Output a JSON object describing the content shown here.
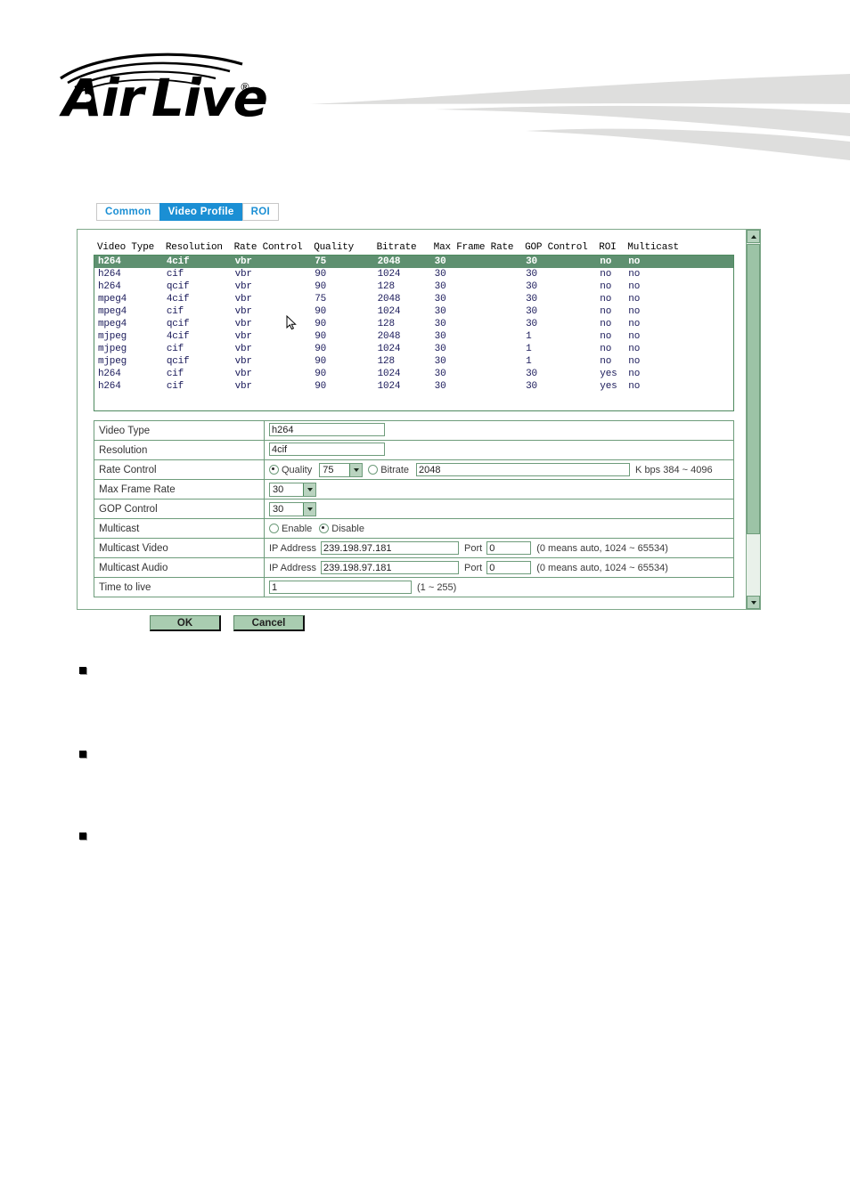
{
  "brand": {
    "name": "AirLive",
    "trademark": "®"
  },
  "tabs": [
    {
      "label": "Common",
      "active": false
    },
    {
      "label": "Video Profile",
      "active": true
    },
    {
      "label": "ROI",
      "active": false
    }
  ],
  "profile_list": {
    "columns": [
      "Video Type",
      "Resolution",
      "Rate Control",
      "Quality",
      "Bitrate",
      "Max Frame Rate",
      "GOP Control",
      "ROI",
      "Multicast"
    ],
    "header_line": "Video Type  Resolution  Rate Control  Quality    Bitrate   Max Frame Rate  GOP Control  ROI  Multicast",
    "rows": [
      {
        "line": "h264        4cif        vbr           75         2048      30              30           no   no",
        "selected": true,
        "video_type": "h264",
        "resolution": "4cif",
        "rate_control": "vbr",
        "quality": "75",
        "bitrate": "2048",
        "max_frame_rate": "30",
        "gop_control": "30",
        "roi": "no",
        "multicast": "no"
      },
      {
        "line": "h264        cif         vbr           90         1024      30              30           no   no",
        "selected": false,
        "video_type": "h264",
        "resolution": "cif",
        "rate_control": "vbr",
        "quality": "90",
        "bitrate": "1024",
        "max_frame_rate": "30",
        "gop_control": "30",
        "roi": "no",
        "multicast": "no"
      },
      {
        "line": "h264        qcif        vbr           90         128       30              30           no   no",
        "selected": false,
        "video_type": "h264",
        "resolution": "qcif",
        "rate_control": "vbr",
        "quality": "90",
        "bitrate": "128",
        "max_frame_rate": "30",
        "gop_control": "30",
        "roi": "no",
        "multicast": "no"
      },
      {
        "line": "mpeg4       4cif        vbr           75         2048      30              30           no   no",
        "selected": false,
        "video_type": "mpeg4",
        "resolution": "4cif",
        "rate_control": "vbr",
        "quality": "75",
        "bitrate": "2048",
        "max_frame_rate": "30",
        "gop_control": "30",
        "roi": "no",
        "multicast": "no"
      },
      {
        "line": "mpeg4       cif         vbr           90         1024      30              30           no   no",
        "selected": false,
        "video_type": "mpeg4",
        "resolution": "cif",
        "rate_control": "vbr",
        "quality": "90",
        "bitrate": "1024",
        "max_frame_rate": "30",
        "gop_control": "30",
        "roi": "no",
        "multicast": "no"
      },
      {
        "line": "mpeg4       qcif        vbr           90         128       30              30           no   no",
        "selected": false,
        "video_type": "mpeg4",
        "resolution": "qcif",
        "rate_control": "vbr",
        "quality": "90",
        "bitrate": "128",
        "max_frame_rate": "30",
        "gop_control": "30",
        "roi": "no",
        "multicast": "no"
      },
      {
        "line": "mjpeg       4cif        vbr           90         2048      30              1            no   no",
        "selected": false,
        "video_type": "mjpeg",
        "resolution": "4cif",
        "rate_control": "vbr",
        "quality": "90",
        "bitrate": "2048",
        "max_frame_rate": "30",
        "gop_control": "1",
        "roi": "no",
        "multicast": "no"
      },
      {
        "line": "mjpeg       cif         vbr           90         1024      30              1            no   no",
        "selected": false,
        "video_type": "mjpeg",
        "resolution": "cif",
        "rate_control": "vbr",
        "quality": "90",
        "bitrate": "1024",
        "max_frame_rate": "30",
        "gop_control": "1",
        "roi": "no",
        "multicast": "no"
      },
      {
        "line": "mjpeg       qcif        vbr           90         128       30              1            no   no",
        "selected": false,
        "video_type": "mjpeg",
        "resolution": "qcif",
        "rate_control": "vbr",
        "quality": "90",
        "bitrate": "128",
        "max_frame_rate": "30",
        "gop_control": "1",
        "roi": "no",
        "multicast": "no"
      },
      {
        "line": "h264        cif         vbr           90         1024      30              30           yes  no",
        "selected": false,
        "video_type": "h264",
        "resolution": "cif",
        "rate_control": "vbr",
        "quality": "90",
        "bitrate": "1024",
        "max_frame_rate": "30",
        "gop_control": "30",
        "roi": "yes",
        "multicast": "no"
      },
      {
        "line": "h264        cif         vbr           90         1024      30              30           yes  no",
        "selected": false,
        "video_type": "h264",
        "resolution": "cif",
        "rate_control": "vbr",
        "quality": "90",
        "bitrate": "1024",
        "max_frame_rate": "30",
        "gop_control": "30",
        "roi": "yes",
        "multicast": "no"
      }
    ]
  },
  "form": {
    "video_type": {
      "label": "Video Type",
      "value": "h264"
    },
    "resolution": {
      "label": "Resolution",
      "value": "4cif"
    },
    "rate_control": {
      "label": "Rate Control",
      "quality_label": "Quality",
      "quality_value": "75",
      "quality_selected": true,
      "bitrate_label": "Bitrate",
      "bitrate_value": "2048",
      "bitrate_selected": false,
      "hint": "K bps 384 ~ 4096"
    },
    "max_frame_rate": {
      "label": "Max Frame Rate",
      "value": "30"
    },
    "gop_control": {
      "label": "GOP Control",
      "value": "30"
    },
    "multicast": {
      "label": "Multicast",
      "enable_label": "Enable",
      "disable_label": "Disable",
      "enable_selected": false,
      "disable_selected": true
    },
    "multicast_video": {
      "label": "Multicast Video",
      "ip_label": "IP Address",
      "ip_value": "239.198.97.181",
      "port_label": "Port",
      "port_value": "0",
      "hint": "(0 means auto, 1024 ~ 65534)"
    },
    "multicast_audio": {
      "label": "Multicast Audio",
      "ip_label": "IP Address",
      "ip_value": "239.198.97.181",
      "port_label": "Port",
      "port_value": "0",
      "hint": "(0 means auto, 1024 ~ 65534)"
    },
    "time_to_live": {
      "label": "Time to live",
      "value": "1",
      "hint": "(1 ~ 255)"
    }
  },
  "actions": {
    "ok_label": "OK",
    "cancel_label": "Cancel"
  },
  "colors": {
    "tab_active_bg": "#1b8fd4",
    "tab_text": "#1b8fd4",
    "list_selected_bg": "#5e9070",
    "panel_border": "#7fa98a",
    "button_bg": "#a9ccb0",
    "field_border": "#6e9c7b"
  }
}
